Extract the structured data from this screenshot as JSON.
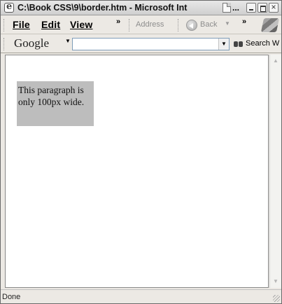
{
  "window": {
    "title": "C:\\Book CSS\\9\\border.htm - Microsoft Int",
    "title_ellipsis": "...",
    "controls": [
      "minimize",
      "maximize",
      "close"
    ]
  },
  "menu": {
    "items": [
      {
        "label": "File",
        "access_key": "F"
      },
      {
        "label": "Edit",
        "access_key": "E"
      },
      {
        "label": "View",
        "access_key": "V"
      }
    ],
    "overflow": "»"
  },
  "toolbar": {
    "address_label": "Address",
    "back_label": "Back",
    "back_dropdown": "▼",
    "overflow": "»"
  },
  "google_bar": {
    "logo": "Google",
    "logo_dropdown": "▼",
    "search_value": "",
    "search_dropdown": "▼",
    "search_button_label": "Search W"
  },
  "content": {
    "paragraph": "This paragraph is only 100px wide."
  },
  "scrollbar": {
    "up": "▲",
    "down": "▼"
  },
  "status": {
    "text": "Done"
  }
}
